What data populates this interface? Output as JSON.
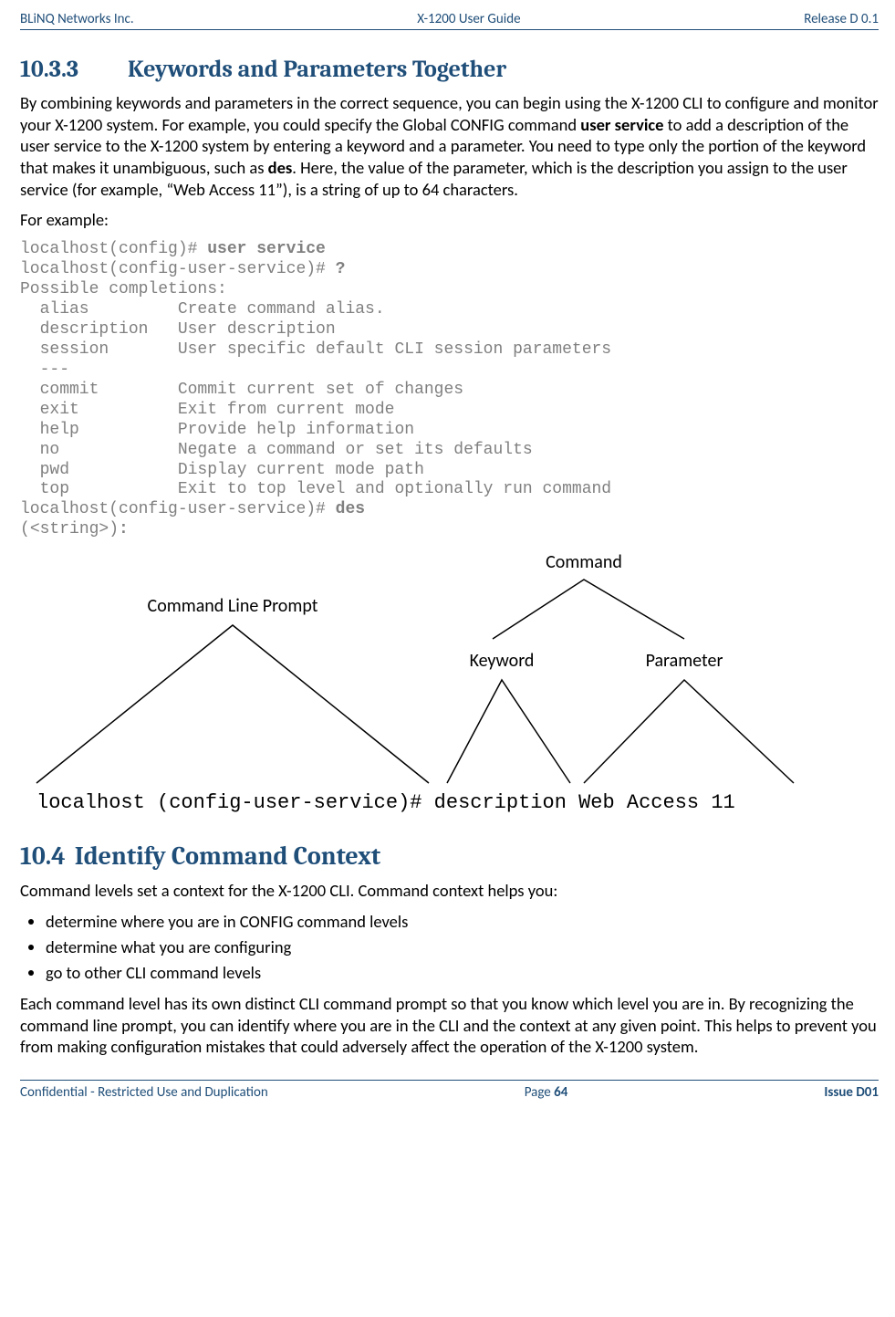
{
  "header": {
    "left": "BLiNQ Networks Inc.",
    "center": "X-1200 User Guide",
    "right": "Release D 0.1"
  },
  "section1": {
    "num": "10.3.3",
    "title": "Keywords and Parameters Together",
    "para1a": "By combining keywords and parameters in the correct sequence, you can begin using the X-1200 CLI to configure and monitor your X-1200 system. For example, you could specify the Global CONFIG command ",
    "bold1": "user service",
    "para1b": " to add a description of the user service to the X-1200 system by entering a keyword and a parameter. You need to type only the portion of the keyword that makes it unambiguous, such as ",
    "bold2": "des",
    "para1c": ". Here, the value of the parameter, which is the description you assign to the user service (for example, “Web Access 11”), is a string of up to 64 characters.",
    "para2": "For example:",
    "cli": {
      "l1a": "localhost(config)# ",
      "l1b": "user service",
      "l2a": "localhost(config-user-service)# ",
      "l2b": "?",
      "l3": "Possible completions:",
      "l4": "  alias         Create command alias.",
      "l5": "  description   User description",
      "l6": "  session       User specific default CLI session parameters",
      "l7": "  ---",
      "l8": "  commit        Commit current set of changes",
      "l9": "  exit          Exit from current mode",
      "l10": "  help          Provide help information",
      "l11": "  no            Negate a command or set its defaults",
      "l12": "  pwd           Display current mode path",
      "l13": "  top           Exit to top level and optionally run command",
      "l14a": "localhost(config-user-service)# ",
      "l14b": "des",
      "l15a": "(",
      "l15b": "<string>",
      "l15c": ")",
      "l15d": ":"
    }
  },
  "diagram": {
    "command": "Command",
    "clp": "Command Line Prompt",
    "keyword": "Keyword",
    "parameter": "Parameter",
    "line": "localhost (config-user-service)# description Web Access 11"
  },
  "section2": {
    "num": "10.4",
    "title": "Identify Command Context",
    "intro": "Command levels set a context for the X-1200 CLI. Command context helps you:",
    "b1": "determine where you are in CONFIG command levels",
    "b2": "determine what you are configuring",
    "b3": "go to other CLI command levels",
    "para": "Each command level has its own distinct CLI command prompt so that you know which level you are in. By recognizing the command line prompt, you can identify where you are in the CLI and the context at any given point. This helps to prevent you from making configuration mistakes that could adversely affect the operation of the X-1200 system."
  },
  "footer": {
    "left": "Confidential - Restricted Use and Duplication",
    "centerA": "Page ",
    "centerB": "64",
    "right": "Issue D01"
  }
}
